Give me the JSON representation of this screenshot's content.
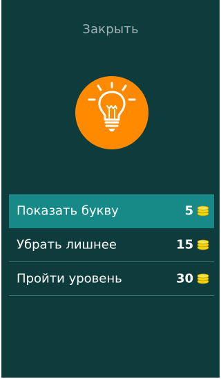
{
  "header": {
    "close_label": "Закрыть"
  },
  "hint_icon": {
    "name": "lightbulb-icon",
    "background_color": "#ff8a00"
  },
  "options": [
    {
      "label": "Показать букву",
      "cost": "5",
      "active": true
    },
    {
      "label": "Убрать лишнее",
      "cost": "15",
      "active": false
    },
    {
      "label": "Пройти уровень",
      "cost": "30",
      "active": false
    }
  ],
  "colors": {
    "background": "#0e3b3c",
    "active_row": "#178a87",
    "coin": "#f2d513"
  }
}
